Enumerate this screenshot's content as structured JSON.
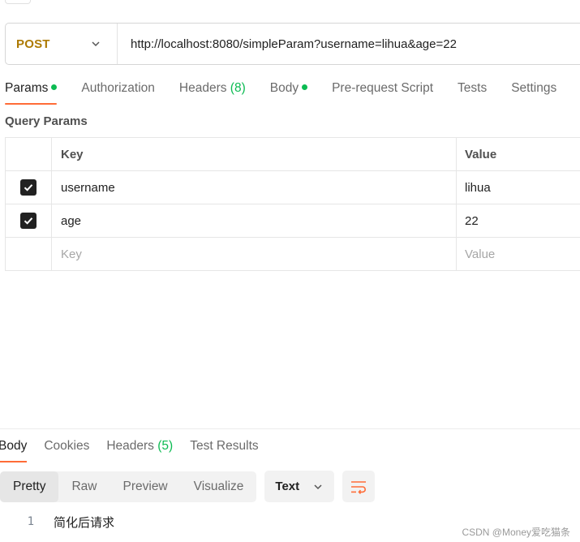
{
  "request": {
    "method": "POST",
    "url": "http://localhost:8080/simpleParam?username=lihua&age=22"
  },
  "tabs": [
    {
      "label": "Params",
      "count": "",
      "dot": true,
      "active": true
    },
    {
      "label": "Authorization",
      "count": "",
      "dot": false,
      "active": false
    },
    {
      "label": "Headers",
      "count": "(8)",
      "dot": false,
      "active": false
    },
    {
      "label": "Body",
      "count": "",
      "dot": true,
      "active": false
    },
    {
      "label": "Pre-request Script",
      "count": "",
      "dot": false,
      "active": false
    },
    {
      "label": "Tests",
      "count": "",
      "dot": false,
      "active": false
    },
    {
      "label": "Settings",
      "count": "",
      "dot": false,
      "active": false
    }
  ],
  "query_params": {
    "title": "Query Params",
    "headers": {
      "key": "Key",
      "value": "Value"
    },
    "rows": [
      {
        "checked": true,
        "key": "username",
        "value": "lihua"
      },
      {
        "checked": true,
        "key": "age",
        "value": "22"
      }
    ],
    "placeholder": {
      "key": "Key",
      "value": "Value"
    }
  },
  "response": {
    "tabs": [
      {
        "label": "Body",
        "count": "",
        "active": true
      },
      {
        "label": "Cookies",
        "count": "",
        "active": false
      },
      {
        "label": "Headers",
        "count": "(5)",
        "active": false
      },
      {
        "label": "Test Results",
        "count": "",
        "active": false
      }
    ],
    "views": [
      "Pretty",
      "Raw",
      "Preview",
      "Visualize"
    ],
    "active_view": "Pretty",
    "format": "Text",
    "lines": [
      {
        "no": "1",
        "text": "简化后请求"
      }
    ]
  },
  "watermark": "CSDN @Money爱吃猫条",
  "colors": {
    "accent": "#ff6c37",
    "method": "#ad7a03",
    "dot": "#0cbb52"
  }
}
